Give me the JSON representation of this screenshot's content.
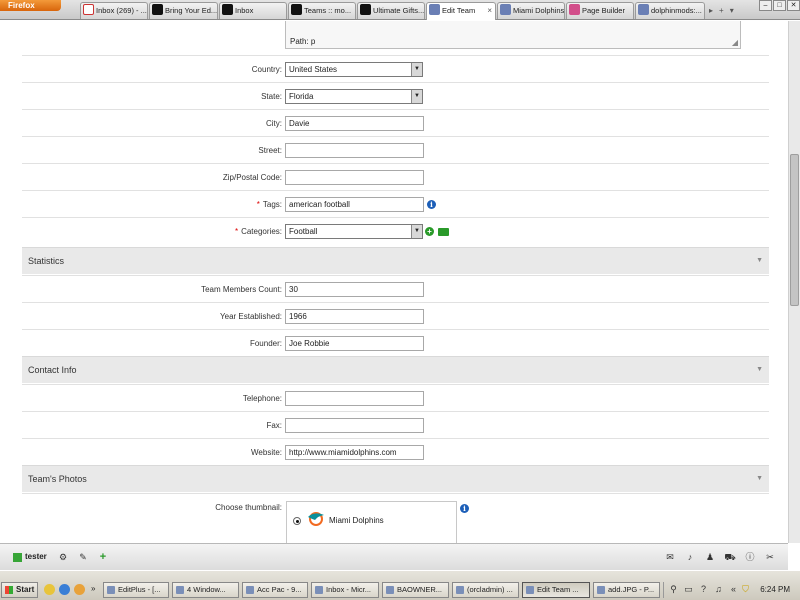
{
  "browser": {
    "app_button": "Firefox",
    "tabs": [
      {
        "label": "Inbox (269) - ...",
        "favicon": "gmail-icon",
        "active": false
      },
      {
        "label": "Bring Your Ed...",
        "favicon": "dolphin-icon",
        "active": false
      },
      {
        "label": "Inbox",
        "favicon": "dolphin-icon",
        "active": false
      },
      {
        "label": "Teams :: mo...",
        "favicon": "dolphin-icon",
        "active": false
      },
      {
        "label": "Ultimate Gifts...",
        "favicon": "dolphin-icon",
        "active": false
      },
      {
        "label": "Edit Team",
        "favicon": "boonex-icon",
        "active": true
      },
      {
        "label": "Miami Dolphins",
        "favicon": "boonex-icon",
        "active": false
      },
      {
        "label": "Page Builder",
        "favicon": "boonex-icon",
        "active": false
      },
      {
        "label": "dolphinmods:...",
        "favicon": "boonex-icon",
        "active": false
      }
    ],
    "tab_close": "×"
  },
  "editor": {
    "path": "Path: p"
  },
  "form": {
    "country": {
      "label": "Country:",
      "value": "United States"
    },
    "state": {
      "label": "State:",
      "value": "Florida"
    },
    "city": {
      "label": "City:",
      "value": "Davie"
    },
    "street": {
      "label": "Street:",
      "value": ""
    },
    "zip": {
      "label": "Zip/Postal Code:",
      "value": ""
    },
    "tags": {
      "label": "Tags:",
      "value": "american football",
      "required": "*"
    },
    "categories": {
      "label": "Categories:",
      "value": "Football",
      "required": "*"
    }
  },
  "sections": {
    "statistics": "Statistics",
    "contact": "Contact Info",
    "photos": "Team's Photos"
  },
  "statistics": {
    "members": {
      "label": "Team Members Count:",
      "value": "30"
    },
    "established": {
      "label": "Year Established:",
      "value": "1966"
    },
    "founder": {
      "label": "Founder:",
      "value": "Joe Robbie"
    }
  },
  "contact": {
    "telephone": {
      "label": "Telephone:",
      "value": ""
    },
    "fax": {
      "label": "Fax:",
      "value": ""
    },
    "website": {
      "label": "Website:",
      "value": "http://www.miamidolphins.com"
    }
  },
  "photos": {
    "thumbnail_label": "Choose thumbnail:",
    "option": "Miami Dolphins"
  },
  "toolbar": {
    "username": "tester"
  },
  "taskbar": {
    "start": "Start",
    "buttons": [
      "EditPlus - [...",
      "4 Window...",
      "Acc Pac - 9...",
      "Inbox - Micr...",
      "BAOWNER...",
      "(orcladmin) ...",
      "Edit Team ...",
      "add.JPG - P..."
    ],
    "clock": "6:24 PM"
  },
  "colors": {
    "firefox_orange": "#e07516",
    "required": "#dd0000",
    "info_blue": "#1d5fb8",
    "add_green": "#2a9a2a",
    "dolphin_aqua": "#0b8f9a",
    "dolphin_orange": "#f26a21"
  }
}
